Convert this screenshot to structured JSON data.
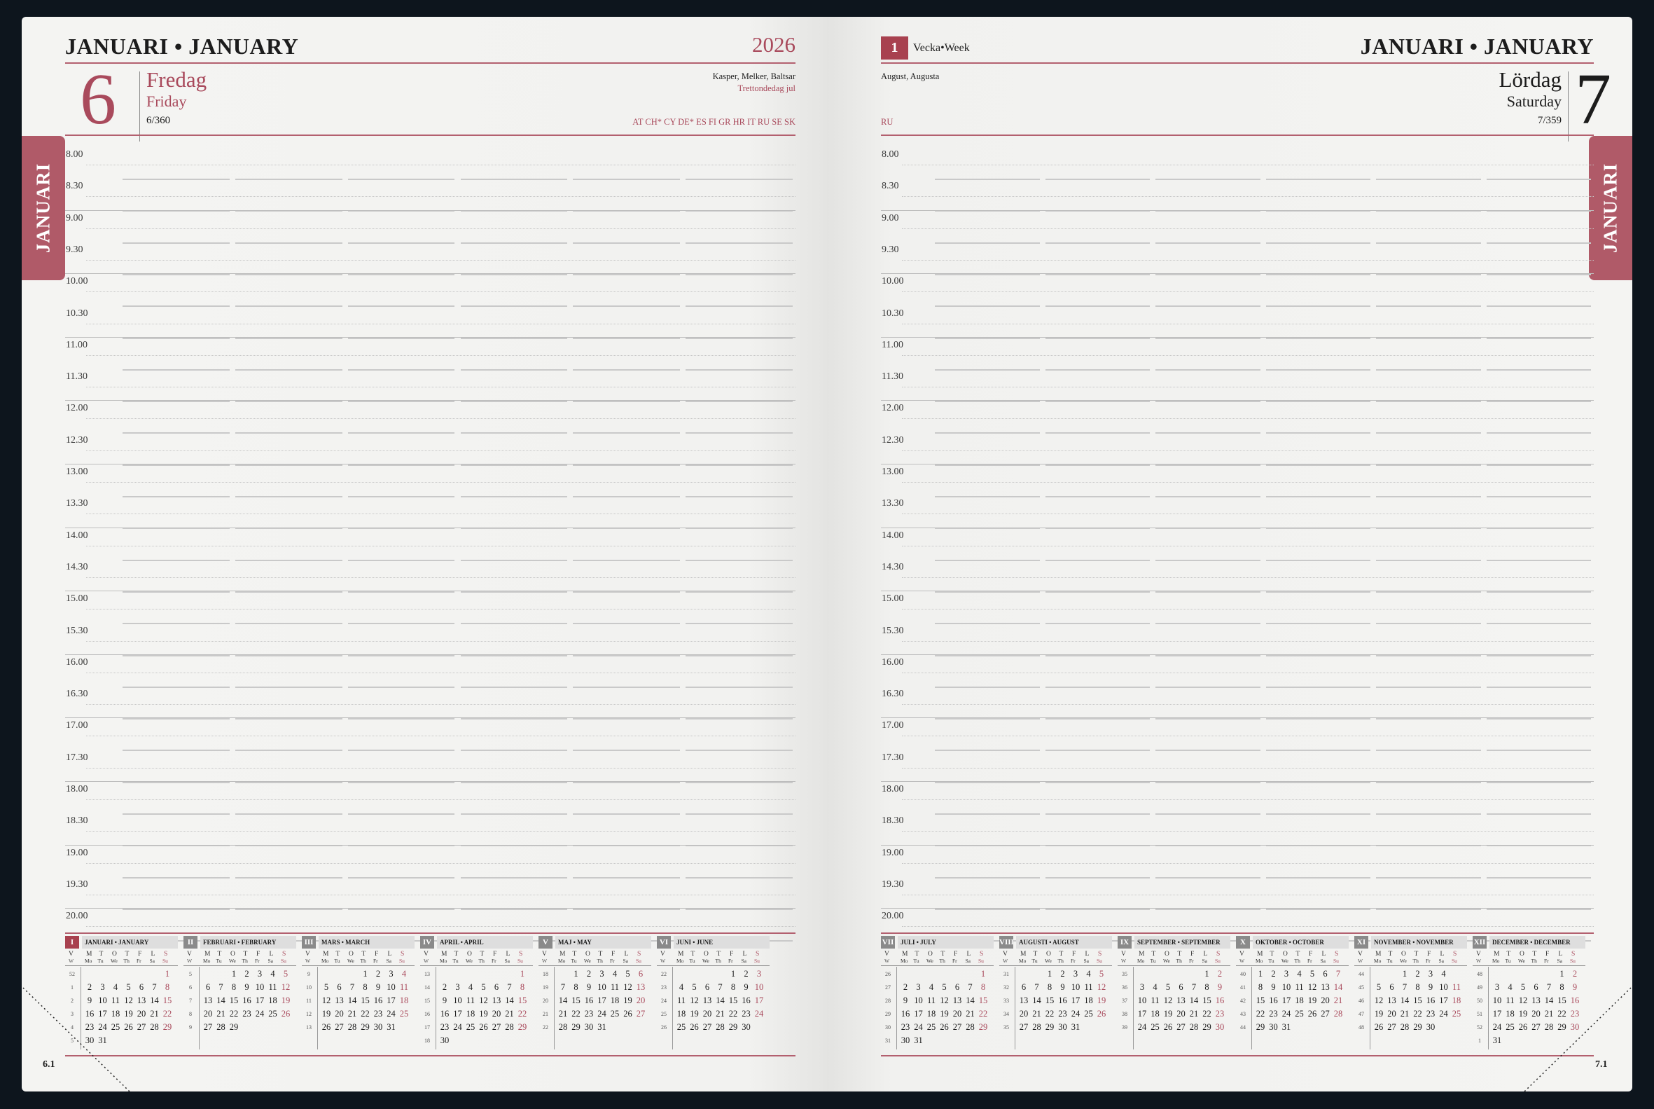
{
  "left": {
    "header": {
      "month": "JANUARI • JANUARY",
      "year": "2026"
    },
    "day": {
      "number": "6",
      "name_sv": "Fredag",
      "name_en": "Friday",
      "ordinal": "6/360",
      "names": "Kasper, Melker, Baltsar",
      "holiday": "Trettondedag jul",
      "countries": "AT CH* CY DE* ES FI GR HR IT RU SE SK"
    },
    "tab": "JANUARI",
    "folio": "6.1"
  },
  "right": {
    "header": {
      "month": "JANUARI • JANUARY",
      "week_number": "1",
      "week_label": "Vecka•Week"
    },
    "day": {
      "number": "7",
      "name_sv": "Lördag",
      "name_en": "Saturday",
      "ordinal": "7/359",
      "names": "August, Augusta",
      "countries": "RU"
    },
    "tab": "JANUARI",
    "folio": "7.1"
  },
  "times": [
    "8.00",
    "8.30",
    "9.00",
    "9.30",
    "10.00",
    "10.30",
    "11.00",
    "11.30",
    "12.00",
    "12.30",
    "13.00",
    "13.30",
    "14.00",
    "14.30",
    "15.00",
    "15.30",
    "16.00",
    "16.30",
    "17.00",
    "17.30",
    "18.00",
    "18.30",
    "19.00",
    "19.30",
    "20.00"
  ],
  "mini_calendar": {
    "week_letters": {
      "sv": [
        "M",
        "T",
        "O",
        "T",
        "F",
        "L",
        "S"
      ],
      "en": [
        "Mo",
        "Tu",
        "We",
        "Th",
        "Fr",
        "Sa",
        "Su"
      ],
      "v": "V",
      "w": "W"
    },
    "colors": {
      "current": "#a8414f",
      "other": "#8a8a8a",
      "holiday": "#a94a5c"
    },
    "left_months": [
      {
        "num": "I",
        "title": "JANUARI • JANUARY",
        "current": true,
        "weeks": [
          "52",
          "1",
          "2",
          "3",
          "4",
          "5"
        ],
        "rows": [
          [
            "",
            "",
            "",
            "",
            "",
            "",
            "1"
          ],
          [
            "2",
            "3",
            "4",
            "5",
            "6",
            "7",
            "8"
          ],
          [
            "9",
            "10",
            "11",
            "12",
            "13",
            "14",
            "15"
          ],
          [
            "16",
            "17",
            "18",
            "19",
            "20",
            "21",
            "22"
          ],
          [
            "23",
            "24",
            "25",
            "26",
            "27",
            "28",
            "29"
          ],
          [
            "30",
            "31",
            "",
            "",
            "",
            "",
            ""
          ]
        ]
      },
      {
        "num": "II",
        "title": "FEBRUARI • FEBRUARY",
        "current": false,
        "weeks": [
          "5",
          "6",
          "7",
          "8",
          "9",
          ""
        ],
        "rows": [
          [
            "",
            "",
            "1",
            "2",
            "3",
            "4",
            "5"
          ],
          [
            "6",
            "7",
            "8",
            "9",
            "10",
            "11",
            "12"
          ],
          [
            "13",
            "14",
            "15",
            "16",
            "17",
            "18",
            "19"
          ],
          [
            "20",
            "21",
            "22",
            "23",
            "24",
            "25",
            "26"
          ],
          [
            "27",
            "28",
            "29",
            "",
            "",
            "",
            ""
          ],
          [
            "",
            "",
            "",
            "",
            "",
            "",
            ""
          ]
        ]
      },
      {
        "num": "III",
        "title": "MARS • MARCH",
        "current": false,
        "weeks": [
          "9",
          "10",
          "11",
          "12",
          "13",
          ""
        ],
        "rows": [
          [
            "",
            "",
            "",
            "1",
            "2",
            "3",
            "4"
          ],
          [
            "5",
            "6",
            "7",
            "8",
            "9",
            "10",
            "11"
          ],
          [
            "12",
            "13",
            "14",
            "15",
            "16",
            "17",
            "18"
          ],
          [
            "19",
            "20",
            "21",
            "22",
            "23",
            "24",
            "25"
          ],
          [
            "26",
            "27",
            "28",
            "29",
            "30",
            "31",
            ""
          ],
          [
            "",
            "",
            "",
            "",
            "",
            "",
            ""
          ]
        ]
      },
      {
        "num": "IV",
        "title": "APRIL • APRIL",
        "current": false,
        "weeks": [
          "13",
          "14",
          "15",
          "16",
          "17",
          "18"
        ],
        "rows": [
          [
            "",
            "",
            "",
            "",
            "",
            "",
            "1"
          ],
          [
            "2",
            "3",
            "4",
            "5",
            "6",
            "7",
            "8"
          ],
          [
            "9",
            "10",
            "11",
            "12",
            "13",
            "14",
            "15"
          ],
          [
            "16",
            "17",
            "18",
            "19",
            "20",
            "21",
            "22"
          ],
          [
            "23",
            "24",
            "25",
            "26",
            "27",
            "28",
            "29"
          ],
          [
            "30",
            "",
            "",
            "",
            "",
            "",
            ""
          ]
        ]
      },
      {
        "num": "V",
        "title": "MAJ • MAY",
        "current": false,
        "weeks": [
          "18",
          "19",
          "20",
          "21",
          "22",
          ""
        ],
        "rows": [
          [
            "",
            "1",
            "2",
            "3",
            "4",
            "5",
            "6"
          ],
          [
            "7",
            "8",
            "9",
            "10",
            "11",
            "12",
            "13"
          ],
          [
            "14",
            "15",
            "16",
            "17",
            "18",
            "19",
            "20"
          ],
          [
            "21",
            "22",
            "23",
            "24",
            "25",
            "26",
            "27"
          ],
          [
            "28",
            "29",
            "30",
            "31",
            "",
            "",
            ""
          ],
          [
            "",
            "",
            "",
            "",
            "",
            "",
            ""
          ]
        ]
      },
      {
        "num": "VI",
        "title": "JUNI • JUNE",
        "current": false,
        "weeks": [
          "22",
          "23",
          "24",
          "25",
          "26",
          ""
        ],
        "rows": [
          [
            "",
            "",
            "",
            "",
            "1",
            "2",
            "3"
          ],
          [
            "4",
            "5",
            "6",
            "7",
            "8",
            "9",
            "10"
          ],
          [
            "11",
            "12",
            "13",
            "14",
            "15",
            "16",
            "17"
          ],
          [
            "18",
            "19",
            "20",
            "21",
            "22",
            "23",
            "24"
          ],
          [
            "25",
            "26",
            "27",
            "28",
            "29",
            "30",
            ""
          ],
          [
            "",
            "",
            "",
            "",
            "",
            "",
            ""
          ]
        ]
      }
    ],
    "right_months": [
      {
        "num": "VII",
        "title": "JULI • JULY",
        "current": false,
        "weeks": [
          "26",
          "27",
          "28",
          "29",
          "30",
          "31"
        ],
        "rows": [
          [
            "",
            "",
            "",
            "",
            "",
            "",
            "1"
          ],
          [
            "2",
            "3",
            "4",
            "5",
            "6",
            "7",
            "8"
          ],
          [
            "9",
            "10",
            "11",
            "12",
            "13",
            "14",
            "15"
          ],
          [
            "16",
            "17",
            "18",
            "19",
            "20",
            "21",
            "22"
          ],
          [
            "23",
            "24",
            "25",
            "26",
            "27",
            "28",
            "29"
          ],
          [
            "30",
            "31",
            "",
            "",
            "",
            "",
            ""
          ]
        ]
      },
      {
        "num": "VIII",
        "title": "AUGUSTI • AUGUST",
        "current": false,
        "weeks": [
          "31",
          "32",
          "33",
          "34",
          "35",
          ""
        ],
        "rows": [
          [
            "",
            "",
            "1",
            "2",
            "3",
            "4",
            "5"
          ],
          [
            "6",
            "7",
            "8",
            "9",
            "10",
            "11",
            "12"
          ],
          [
            "13",
            "14",
            "15",
            "16",
            "17",
            "18",
            "19"
          ],
          [
            "20",
            "21",
            "22",
            "23",
            "24",
            "25",
            "26"
          ],
          [
            "27",
            "28",
            "29",
            "30",
            "31",
            "",
            ""
          ],
          [
            "",
            "",
            "",
            "",
            "",
            "",
            ""
          ]
        ]
      },
      {
        "num": "IX",
        "title": "SEPTEMBER • SEPTEMBER",
        "current": false,
        "weeks": [
          "35",
          "36",
          "37",
          "38",
          "39",
          ""
        ],
        "rows": [
          [
            "",
            "",
            "",
            "",
            "",
            "1",
            "2"
          ],
          [
            "3",
            "4",
            "5",
            "6",
            "7",
            "8",
            "9"
          ],
          [
            "10",
            "11",
            "12",
            "13",
            "14",
            "15",
            "16"
          ],
          [
            "17",
            "18",
            "19",
            "20",
            "21",
            "22",
            "23"
          ],
          [
            "24",
            "25",
            "26",
            "27",
            "28",
            "29",
            "30"
          ],
          [
            "",
            "",
            "",
            "",
            "",
            "",
            ""
          ]
        ]
      },
      {
        "num": "X",
        "title": "OKTOBER • OCTOBER",
        "current": false,
        "weeks": [
          "40",
          "41",
          "42",
          "43",
          "44",
          ""
        ],
        "rows": [
          [
            "1",
            "2",
            "3",
            "4",
            "5",
            "6",
            "7"
          ],
          [
            "8",
            "9",
            "10",
            "11",
            "12",
            "13",
            "14"
          ],
          [
            "15",
            "16",
            "17",
            "18",
            "19",
            "20",
            "21"
          ],
          [
            "22",
            "23",
            "24",
            "25",
            "26",
            "27",
            "28"
          ],
          [
            "29",
            "30",
            "31",
            "",
            "",
            "",
            ""
          ],
          [
            "",
            "",
            "",
            "",
            "",
            "",
            ""
          ]
        ]
      },
      {
        "num": "XI",
        "title": "NOVEMBER • NOVEMBER",
        "current": false,
        "weeks": [
          "44",
          "45",
          "46",
          "47",
          "48",
          ""
        ],
        "rows": [
          [
            "",
            "",
            "1",
            "2",
            "3",
            "4",
            ""
          ],
          [
            "5",
            "6",
            "7",
            "8",
            "9",
            "10",
            "11"
          ],
          [
            "12",
            "13",
            "14",
            "15",
            "16",
            "17",
            "18"
          ],
          [
            "19",
            "20",
            "21",
            "22",
            "23",
            "24",
            "25"
          ],
          [
            "26",
            "27",
            "28",
            "29",
            "30",
            "",
            ""
          ],
          [
            "",
            "",
            "",
            "",
            "",
            "",
            ""
          ]
        ]
      },
      {
        "num": "XII",
        "title": "DECEMBER • DECEMBER",
        "current": false,
        "weeks": [
          "48",
          "49",
          "50",
          "51",
          "52",
          "1"
        ],
        "rows": [
          [
            "",
            "",
            "",
            "",
            "",
            "1",
            "2"
          ],
          [
            "3",
            "4",
            "5",
            "6",
            "7",
            "8",
            "9"
          ],
          [
            "10",
            "11",
            "12",
            "13",
            "14",
            "15",
            "16"
          ],
          [
            "17",
            "18",
            "19",
            "20",
            "21",
            "22",
            "23"
          ],
          [
            "24",
            "25",
            "26",
            "27",
            "28",
            "29",
            "30"
          ],
          [
            "31",
            "",
            "",
            "",
            "",
            "",
            ""
          ]
        ]
      }
    ]
  }
}
